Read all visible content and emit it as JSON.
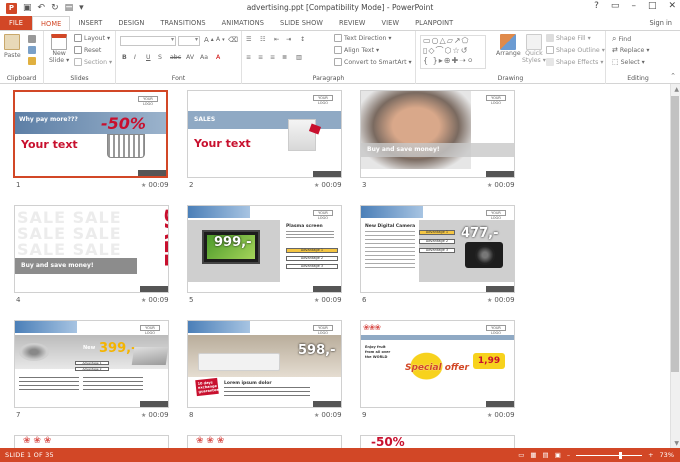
{
  "window": {
    "title": "advertising.ppt [Compatibility Mode] - PowerPoint",
    "app_letter": "P"
  },
  "tabs": [
    "FILE",
    "HOME",
    "INSERT",
    "DESIGN",
    "TRANSITIONS",
    "ANIMATIONS",
    "SLIDE SHOW",
    "REVIEW",
    "VIEW",
    "PLANPOINT"
  ],
  "active_tab": "HOME",
  "sign_in": "Sign in",
  "ribbon": {
    "clipboard": {
      "label": "Clipboard",
      "paste": "Paste"
    },
    "slides": {
      "label": "Slides",
      "new_slide": "New",
      "new_slide2": "Slide ▾",
      "layout": "Layout ▾",
      "reset": "Reset",
      "section": "Section ▾"
    },
    "font": {
      "label": "Font"
    },
    "paragraph": {
      "label": "Paragraph",
      "text_direction": "Text Direction ▾",
      "align_text": "Align Text ▾",
      "convert_smartart": "Convert to SmartArt ▾"
    },
    "drawing": {
      "label": "Drawing",
      "arrange": "Arrange",
      "quick_styles": "Quick",
      "quick_styles2": "Styles ▾",
      "shape_fill": "Shape Fill ▾",
      "shape_outline": "Shape Outline ▾",
      "shape_effects": "Shape Effects ▾"
    },
    "editing": {
      "label": "Editing",
      "find": "Find",
      "replace": "Replace ▾",
      "select": "Select ▾"
    }
  },
  "slides": [
    {
      "num": "1",
      "time": "00:09",
      "headline": "Why pay more???",
      "body": "Your text",
      "badge": "-50%"
    },
    {
      "num": "2",
      "time": "00:09",
      "headline": "SALES",
      "body": "Your text"
    },
    {
      "num": "3",
      "time": "00:09",
      "body": "Buy and save money!"
    },
    {
      "num": "4",
      "time": "00:09",
      "body": "Buy and save money!",
      "badge": "SALE"
    },
    {
      "num": "5",
      "time": "00:09",
      "price": "999,-",
      "heading": "Plasma screen",
      "list": [
        "Advantage 1",
        "Advantage 2",
        "Advantage 3"
      ]
    },
    {
      "num": "6",
      "time": "00:09",
      "price": "477,-",
      "heading": "New Digital Camera",
      "list": [
        "Advantage 1",
        "Advantage 2",
        "Advantage 3"
      ]
    },
    {
      "num": "7",
      "time": "00:09",
      "price": "399,-",
      "heading": "New",
      "list": [
        "Advantage 1",
        "Advantage 2"
      ]
    },
    {
      "num": "8",
      "time": "00:09",
      "price": "598,-",
      "heading": "Lorem ipsum dolor",
      "badge": "10 days exchange guarantee"
    },
    {
      "num": "9",
      "time": "00:09",
      "price": "1,99",
      "body": "Special offer",
      "heading": "Enjoy fruit from all over the WORLD"
    }
  ],
  "logo_text": "YOUR LOGO",
  "status": {
    "slide_info": "SLIDE 1 OF 35",
    "zoom": "73%"
  }
}
